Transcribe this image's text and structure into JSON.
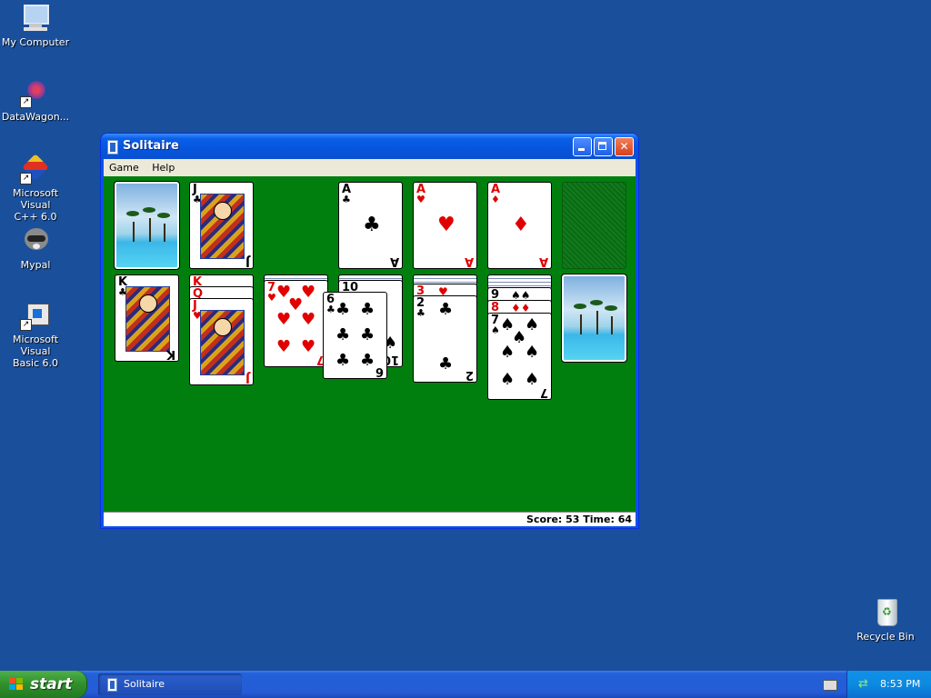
{
  "desktop": {
    "icons": [
      {
        "label": "My Computer"
      },
      {
        "label": "DataWagon..."
      },
      {
        "label": "Microsoft Visual\nC++ 6.0"
      },
      {
        "label": "Mypal"
      },
      {
        "label": "Microsoft Visual\nBasic 6.0"
      },
      {
        "label": "Recycle Bin"
      }
    ]
  },
  "window": {
    "title": "Solitaire",
    "menu": [
      "Game",
      "Help"
    ],
    "status": "Score: 53 Time: 64"
  },
  "cards": {
    "waste": {
      "rank": "J",
      "suit": "♣"
    },
    "foundations": [
      {
        "rank": "A",
        "suit": "♣"
      },
      {
        "rank": "A",
        "suit": "♥"
      },
      {
        "rank": "A",
        "suit": "♦"
      }
    ],
    "tableau": [
      {
        "top_rank": "K",
        "top_suit": "♣"
      },
      {
        "buried_rank": "K",
        "buried_rank2": "Q",
        "top_rank": "J",
        "top_suit": "♥"
      },
      {
        "top_rank": "7",
        "top_suit": "♥",
        "bottom_rank": "7"
      },
      {
        "buried_rank": "10",
        "buried_bottom": "10",
        "top_rank": "6",
        "top_suit": "♣",
        "top_bottom": "6"
      },
      {
        "buried_rank": "3",
        "top_rank": "2",
        "top_suit": "♣",
        "bottom_rank": "2"
      },
      {
        "buried_rank": "9",
        "buried_rank2": "8",
        "top_rank": "7",
        "top_suit": "♠",
        "bottom_rank": "7"
      }
    ]
  },
  "taskbar": {
    "start_label": "start",
    "task_label": "Solitaire",
    "clock": "8:53 PM"
  },
  "colors": {
    "desktop": "#1a4f9b",
    "felt": "#007f0e",
    "red_suit": "#e00000"
  }
}
